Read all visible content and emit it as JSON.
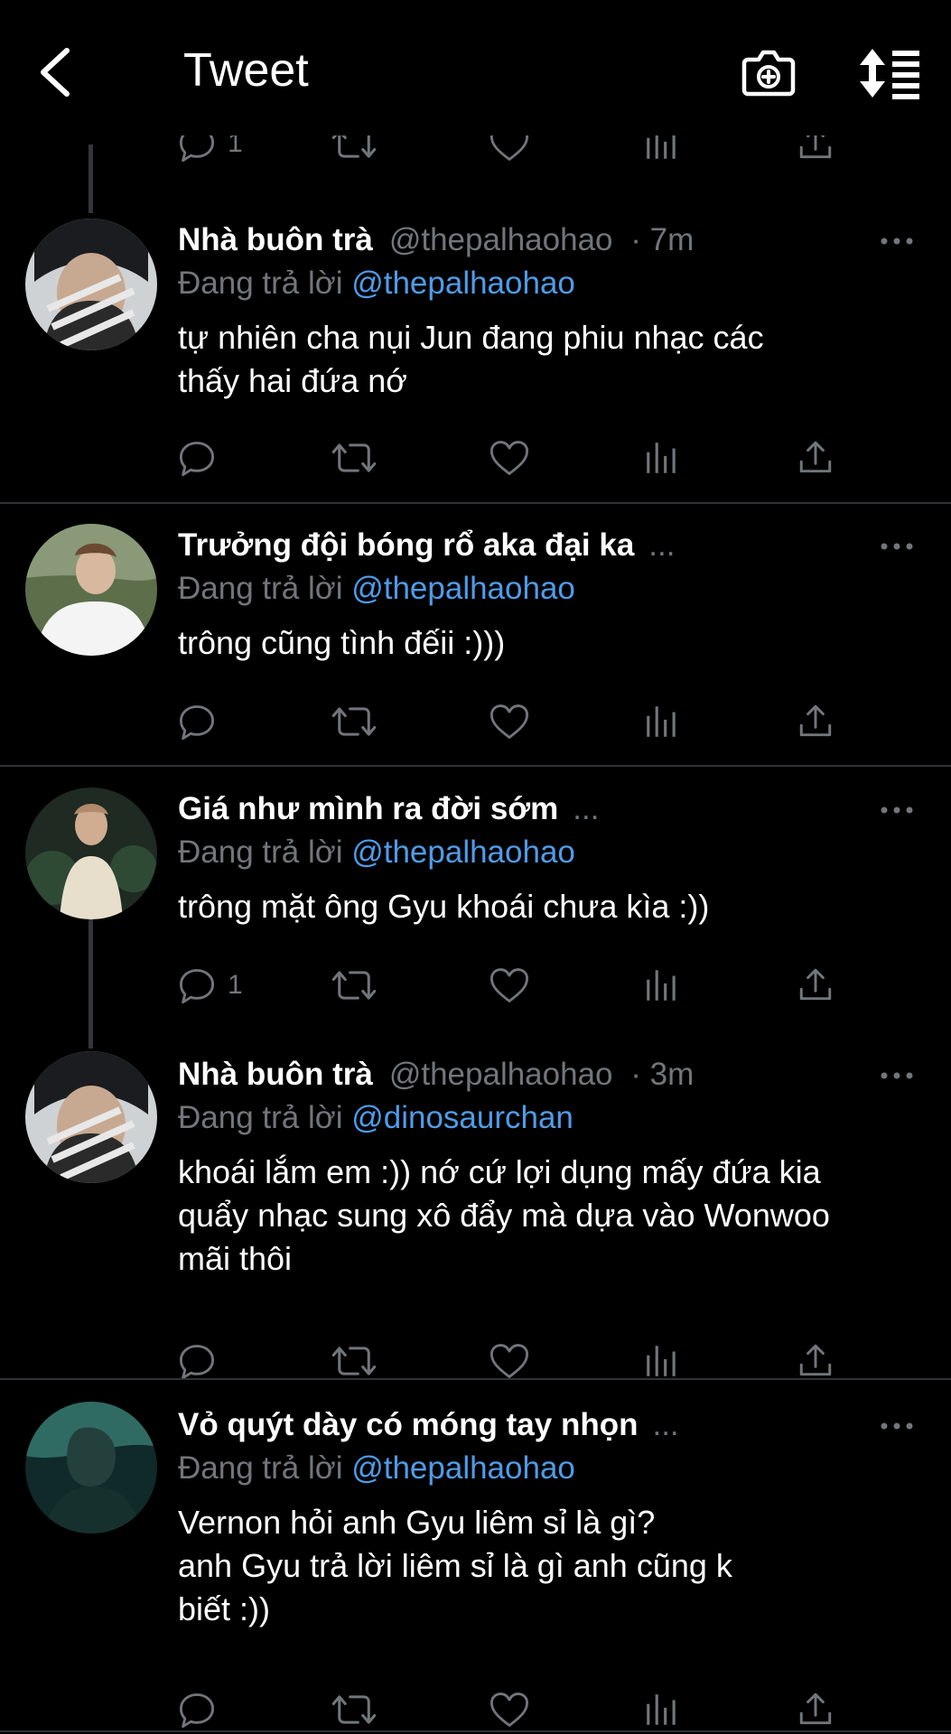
{
  "header": {
    "title": "Tweet"
  },
  "colors": {
    "background": "#000000",
    "muted": "#71767b",
    "link": "#4f9ce8",
    "divider": "#2f3336"
  },
  "top_partial": {
    "reply_count": "1"
  },
  "tweets": [
    {
      "name": "Nhà buôn trà",
      "handle": "@thepalhaohao",
      "time": "· 7m",
      "reply_prefix": "Đang trả lời",
      "reply_to": "@thepalhaohao",
      "lines": [
        "tự nhiên cha nụi Jun đang phiu nhạc các",
        "thấy hai đứa nớ"
      ],
      "reply_count": ""
    },
    {
      "name": "Trưởng đội bóng rổ aka đại ka",
      "handle": "",
      "time": "...",
      "reply_prefix": "Đang trả lời",
      "reply_to": "@thepalhaohao",
      "lines": [
        "trông cũng tình đếii :)))"
      ],
      "reply_count": ""
    },
    {
      "name": "Giá như mình ra đời sớm",
      "handle": "",
      "time": "...",
      "reply_prefix": "Đang trả lời",
      "reply_to": "@thepalhaohao",
      "lines": [
        "trông mặt ông Gyu khoái chưa kìa :))"
      ],
      "reply_count": "1"
    },
    {
      "name": "Nhà buôn trà",
      "handle": "@thepalhaohao",
      "time": "· 3m",
      "reply_prefix": "Đang trả lời",
      "reply_to": "@dinosaurchan",
      "lines": [
        "khoái lắm em :)) nớ cứ lợi dụng mấy đứa kia",
        "quẩy nhạc sung xô đẩy mà dựa vào Wonwoo",
        "mãi thôi"
      ],
      "reply_count": ""
    },
    {
      "name": "Vỏ quýt dày có móng tay nhọn",
      "handle": "",
      "time": "...",
      "reply_prefix": "Đang trả lời",
      "reply_to": "@thepalhaohao",
      "lines": [
        "Vernon hỏi anh Gyu liêm sỉ là gì?",
        "anh Gyu trả lời liêm sỉ là gì anh cũng k",
        "biết :))"
      ],
      "reply_count": ""
    }
  ]
}
